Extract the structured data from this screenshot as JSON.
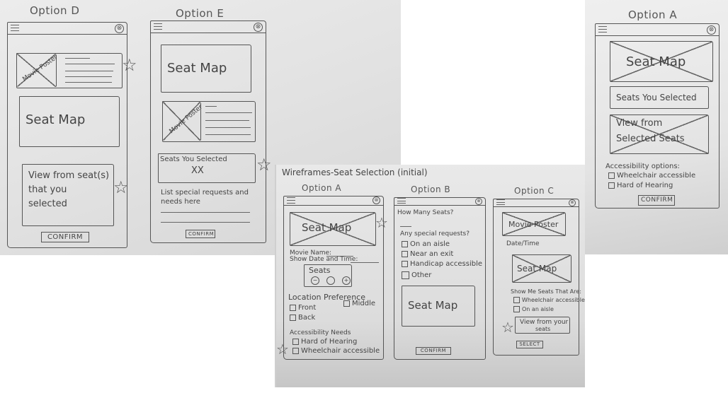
{
  "left_photo": {
    "option_d": {
      "title": "Option D",
      "poster_label": "Movie Poster",
      "seat_map_label": "Seat Map",
      "view_label_lines": [
        "View from seat(s)",
        "that you",
        "selected"
      ],
      "confirm_label": "CONFIRM"
    },
    "option_e": {
      "title": "Option E",
      "seat_map_label": "Seat Map",
      "poster_label": "Movie Poster",
      "seats_selected_label": "Seats You Selected",
      "seats_selected_value": "XX",
      "special_requests_label_lines": [
        "List special requests and",
        "needs here"
      ],
      "confirm_label": "CONFIRM"
    }
  },
  "right_photo": {
    "option_a": {
      "title": "Option A",
      "seat_map_label": "Seat Map",
      "seats_selected_label": "Seats You Selected",
      "view_label_lines": [
        "View from",
        "Selected Seats"
      ],
      "accessibility_heading": "Accessibility options:",
      "accessibility_options": [
        "Wheelchair accessible",
        "Hard of Hearing"
      ],
      "confirm_label": "CONFIRM"
    }
  },
  "center_photo": {
    "heading": "Wireframes-Seat Selection (initial)",
    "option_a": {
      "title": "Option A",
      "seat_map_label": "Seat Map",
      "movie_name_label": "Movie Name:",
      "show_date_label": "Show Date and Time:",
      "seats_label": "Seats",
      "stepper_minus": "−",
      "stepper_plus": "+",
      "location_heading": "Location Preference",
      "location_options": [
        "Front",
        "Middle",
        "Back"
      ],
      "accessibility_heading": "Accessibility Needs",
      "accessibility_options": [
        "Hard of Hearing",
        "Wheelchair accessible"
      ]
    },
    "option_b": {
      "title": "Option B",
      "how_many_label": "How Many Seats?",
      "special_requests_label": "Any special requests?",
      "request_options": [
        "On an aisle",
        "Near an exit",
        "Handicap accessible",
        "Other"
      ],
      "seat_map_label": "Seat Map",
      "confirm_label": "CONFIRM"
    },
    "option_c": {
      "title": "Option C",
      "poster_label": "Movie Poster",
      "date_time_label": "Date/Time",
      "seat_map_label": "Seat Map",
      "show_seats_label": "Show Me Seats That Are:",
      "seat_filters": [
        "Wheelchair accessible",
        "On an aisle"
      ],
      "view_button_lines": [
        "View from your",
        "seats"
      ],
      "select_label": "SELECT"
    }
  },
  "icons": {
    "close": "⊗",
    "star": "☆"
  }
}
